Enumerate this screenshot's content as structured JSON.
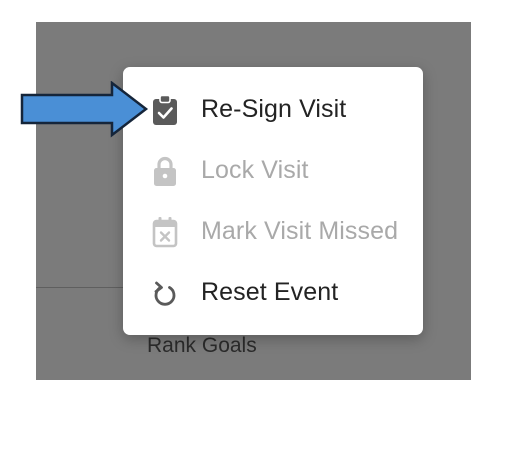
{
  "background": {
    "text": "Rank Goals"
  },
  "menu": {
    "items": [
      {
        "label": "Re-Sign Visit",
        "icon": "clipboard-check-icon",
        "enabled": true
      },
      {
        "label": "Lock Visit",
        "icon": "lock-icon",
        "enabled": false
      },
      {
        "label": "Mark Visit Missed",
        "icon": "calendar-x-icon",
        "enabled": false
      },
      {
        "label": "Reset Event",
        "icon": "reset-icon",
        "enabled": true
      }
    ]
  },
  "colors": {
    "overlay": "#7b7b7b",
    "enabled_text": "#232323",
    "disabled_text": "#a9a9a9",
    "enabled_icon": "#5a5a5a",
    "disabled_icon": "#c4c4c4",
    "arrow_fill": "#4a8fd6",
    "arrow_stroke": "#15253a"
  }
}
